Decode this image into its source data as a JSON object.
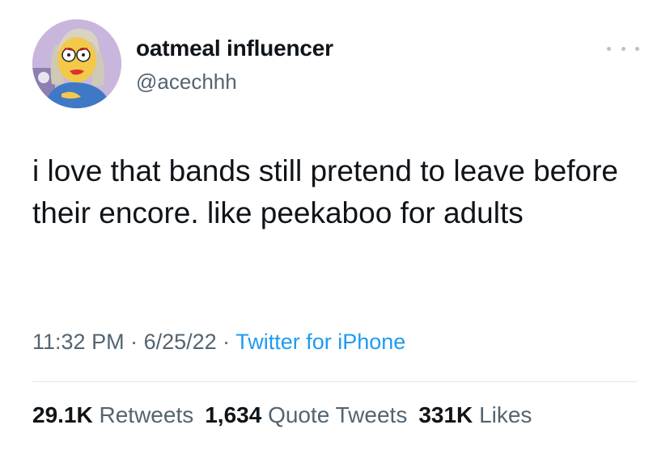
{
  "author": {
    "display_name": "oatmeal influencer",
    "handle": "@acechhh",
    "avatar_icon": "cartoon-character-avatar"
  },
  "more_menu_icon": "more-options-icon",
  "tweet": {
    "text": "i love that bands still pretend to leave before their encore. like peekaboo for adults"
  },
  "meta": {
    "time": "11:32 PM",
    "separator": " · ",
    "date": "6/25/22",
    "source": "Twitter for iPhone"
  },
  "stats": {
    "retweets_count": "29.1K",
    "retweets_label": "Retweets",
    "quote_tweets_count": "1,634",
    "quote_tweets_label": "Quote Tweets",
    "likes_count": "331K",
    "likes_label": "Likes"
  },
  "colors": {
    "link": "#1d9bf0",
    "secondary_text": "#536471",
    "primary_text": "#0f1419"
  }
}
